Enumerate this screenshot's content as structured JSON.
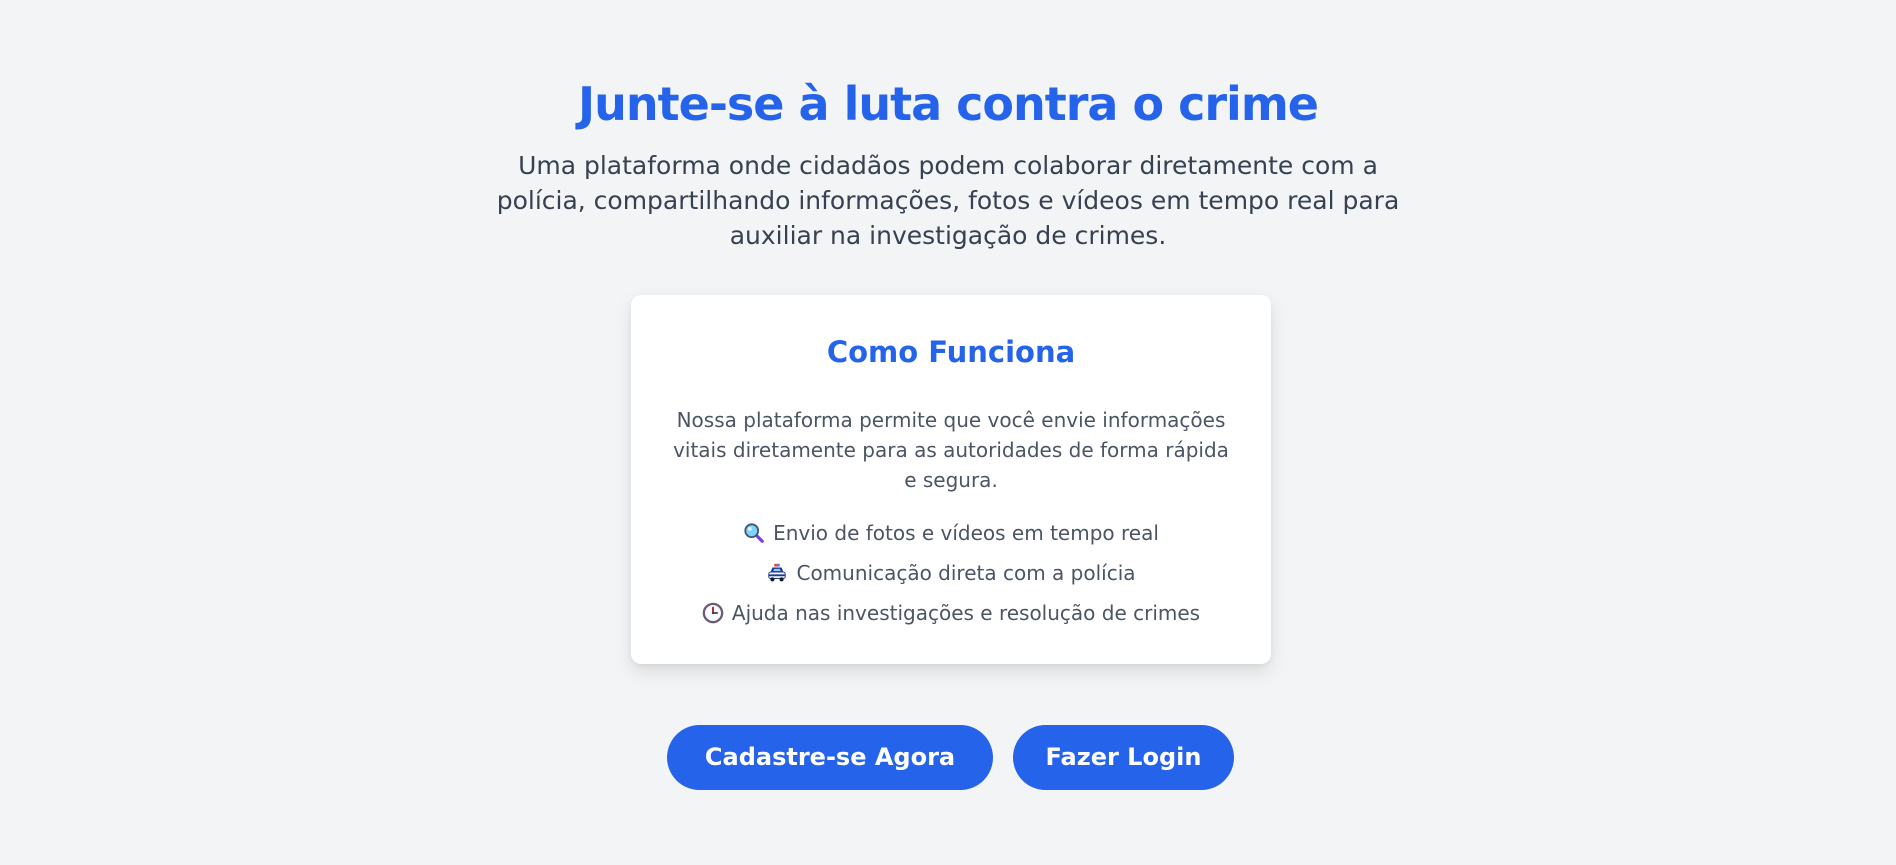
{
  "hero": {
    "title": "Junte-se à luta contra o crime",
    "subtitle": "Uma plataforma onde cidadãos podem colaborar diretamente com a polícia, compartilhando informações, fotos e vídeos em tempo real para auxiliar na investigação de crimes."
  },
  "card": {
    "title": "Como Funciona",
    "description": "Nossa plataforma permite que você envie informações vitais diretamente para as autoridades de forma rápida e segura.",
    "features": [
      {
        "icon": "magnifying-glass-icon",
        "label": "Envio de fotos e vídeos em tempo real"
      },
      {
        "icon": "police-car-icon",
        "label": "Comunicação direta com a polícia"
      },
      {
        "icon": "clock-icon",
        "label": "Ajuda nas investigações e resolução de crimes"
      }
    ]
  },
  "actions": {
    "register_label": "Cadastre-se Agora",
    "login_label": "Fazer Login"
  },
  "colors": {
    "background": "#f2f4f6",
    "accent": "#2563eb",
    "card": "#ffffff",
    "text": "#374151"
  }
}
